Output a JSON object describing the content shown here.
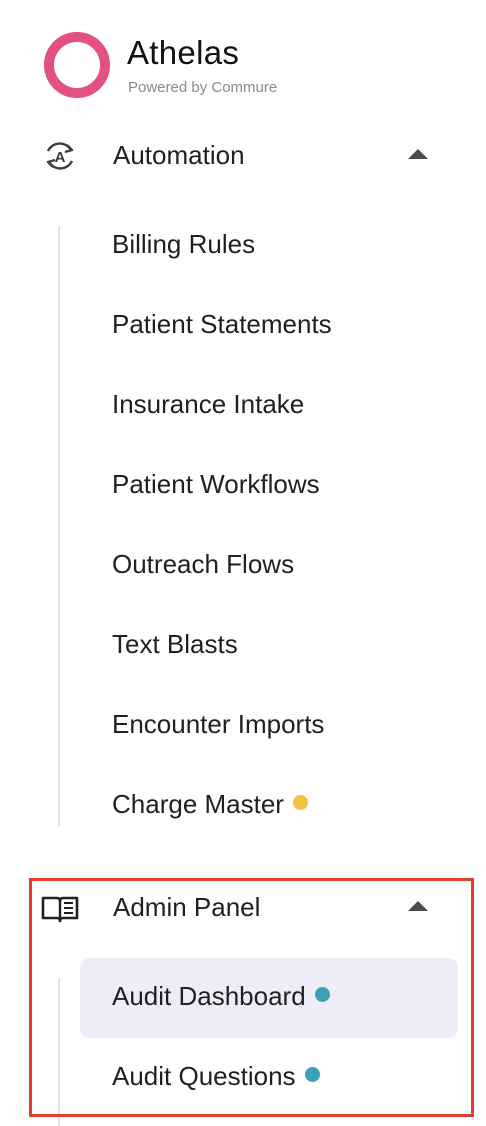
{
  "brand": {
    "name": "Athelas",
    "tagline": "Powered by Commure",
    "logo_color": "#e2517f"
  },
  "sections": [
    {
      "id": "automation",
      "label": "Automation",
      "icon": "automation-cycle-icon",
      "expanded": true,
      "items": [
        {
          "label": "Billing Rules"
        },
        {
          "label": "Patient Statements"
        },
        {
          "label": "Insurance Intake"
        },
        {
          "label": "Patient Workflows"
        },
        {
          "label": "Outreach Flows"
        },
        {
          "label": "Text Blasts"
        },
        {
          "label": "Encounter Imports"
        },
        {
          "label": "Charge Master",
          "dot_color": "#f3c243"
        }
      ]
    },
    {
      "id": "admin-panel",
      "label": "Admin Panel",
      "icon": "open-book-icon",
      "expanded": true,
      "items": [
        {
          "label": "Audit Dashboard",
          "dot_color": "#3d9fb8",
          "active": true
        },
        {
          "label": "Audit Questions",
          "dot_color": "#3d9fb8"
        }
      ]
    }
  ],
  "colors": {
    "highlight_border": "#e0412f",
    "active_item_bg": "#ededf7"
  }
}
